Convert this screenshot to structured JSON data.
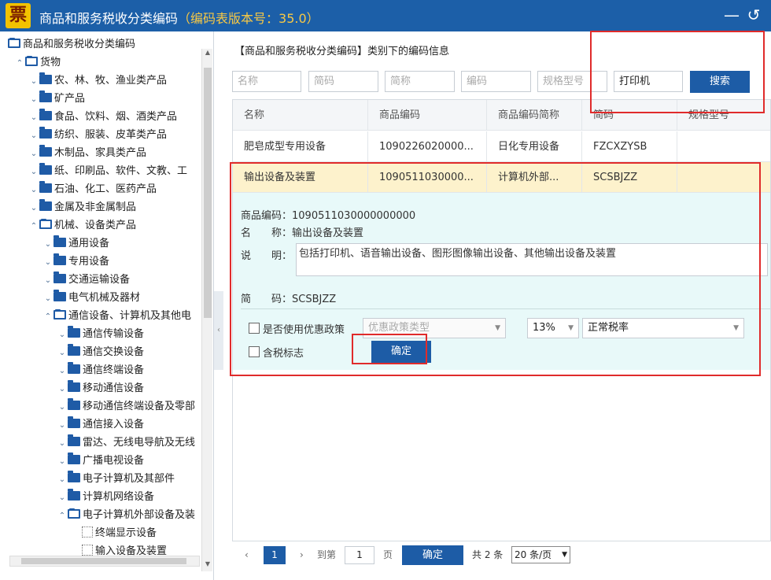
{
  "window": {
    "logo": "票",
    "title": "商品和服务税收分类编码",
    "version": "（编码表版本号：35.0）",
    "minimize_label": "—",
    "back_label": "↺"
  },
  "tree": {
    "nodes": [
      {
        "label": "商品和服务税收分类编码"
      },
      {
        "label": "货物"
      },
      {
        "label": "农、林、牧、渔业类产品"
      },
      {
        "label": "矿产品"
      },
      {
        "label": "食品、饮料、烟、酒类产品"
      },
      {
        "label": "纺织、服装、皮革类产品"
      },
      {
        "label": "木制品、家具类产品"
      },
      {
        "label": "纸、印刷品、软件、文教、工"
      },
      {
        "label": "石油、化工、医药产品"
      },
      {
        "label": "金属及非金属制品"
      },
      {
        "label": "机械、设备类产品"
      },
      {
        "label": "通用设备"
      },
      {
        "label": "专用设备"
      },
      {
        "label": "交通运输设备"
      },
      {
        "label": "电气机械及器材"
      },
      {
        "label": "通信设备、计算机及其他电"
      },
      {
        "label": "通信传输设备"
      },
      {
        "label": "通信交换设备"
      },
      {
        "label": "通信终端设备"
      },
      {
        "label": "移动通信设备"
      },
      {
        "label": "移动通信终端设备及零部"
      },
      {
        "label": "通信接入设备"
      },
      {
        "label": "雷达、无线电导航及无线"
      },
      {
        "label": "广播电视设备"
      },
      {
        "label": "电子计算机及其部件"
      },
      {
        "label": "计算机网络设备"
      },
      {
        "label": "电子计算机外部设备及装"
      },
      {
        "label": "终端显示设备"
      },
      {
        "label": "输入设备及装置"
      }
    ]
  },
  "main": {
    "section_title": "【商品和服务税收分类编码】类别下的编码信息",
    "search": {
      "name_ph": "名称",
      "short_code_ph": "简码",
      "abbr_ph": "简称",
      "code_ph": "编码",
      "spec_ph": "规格型号",
      "keyword_value": "打印机",
      "button": "搜索"
    },
    "grid": {
      "headers": [
        "名称",
        "商品编码",
        "商品编码简称",
        "简码",
        "规格型号"
      ],
      "rows": [
        [
          "肥皂成型专用设备",
          "1090226020000...",
          "日化专用设备",
          "FZCXZYSB",
          ""
        ],
        [
          "输出设备及装置",
          "1090511030000...",
          "计算机外部...",
          "SCSBJZZ",
          ""
        ]
      ]
    },
    "detail": {
      "code_label": "商品编码：",
      "code_value": "1090511030000000000",
      "name_label": "名　　称：",
      "name_value": "输出设备及装置",
      "desc_label": "说　　明：",
      "desc_value": "包括打印机、语音输出设备、图形图像输出设备、其他输出设备及装置",
      "short_label": "简　　码：",
      "short_value": "SCSBJZZ",
      "preferential_label": "是否使用优惠政策",
      "policy_type_ph": "优惠政策类型",
      "tax_rate": "13%",
      "tax_type": "正常税率",
      "tax_included_label": "含税标志",
      "confirm_button": "确定"
    },
    "pager": {
      "current_page": "1",
      "goto_label": "到第",
      "goto_value": "1",
      "page_label": "页",
      "confirm_button": "确定",
      "total": "共 2 条",
      "page_size": "20 条/页"
    }
  },
  "colors": {
    "title_bar": "#1c5fa8",
    "accent_button": "#1d5ca6",
    "selected_row": "#fdf2cc",
    "detail_bg": "#e8f9f9",
    "highlight": "#e02b2b"
  }
}
